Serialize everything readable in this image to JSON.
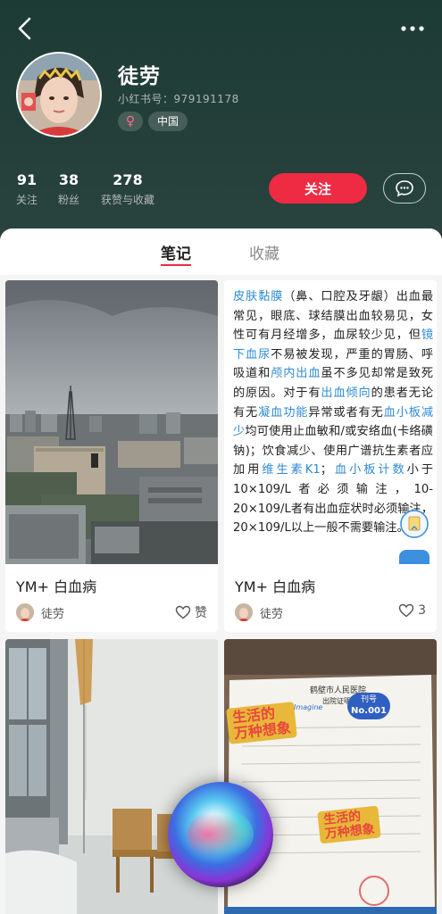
{
  "profile": {
    "nickname": "徒劳",
    "redbook_id": "小红书号：979191178",
    "gender_symbol": "♀",
    "region": "中国",
    "stats": [
      {
        "num": "91",
        "label": "关注"
      },
      {
        "num": "38",
        "label": "粉丝"
      },
      {
        "num": "278",
        "label": "获赞与收藏"
      }
    ],
    "follow_label": "关注"
  },
  "tabs": [
    {
      "label": "笔记",
      "active": true
    },
    {
      "label": "收藏",
      "active": false
    }
  ],
  "notes": [
    {
      "title": "YM+ 白血病",
      "author": "徒劳",
      "likes": "赞"
    },
    {
      "title": "YM+ 白血病",
      "author": "徒劳",
      "likes": "3"
    }
  ],
  "note_text": {
    "segments": [
      [
        "皮肤黏膜",
        true
      ],
      [
        "（鼻、口腔及牙龈）出血最常见，眼底、球结膜出血较易见，女性可有月经增多，血尿较少见，但",
        false
      ],
      [
        "镜下血尿",
        true
      ],
      [
        "不易被发现，严重的胃肠、呼吸道和",
        false
      ],
      [
        "颅内出血",
        true
      ],
      [
        "虽不多见却常是致死的原因。对于有",
        false
      ],
      [
        "出血倾向",
        true
      ],
      [
        "的患者无论有无",
        false
      ],
      [
        "凝血功能",
        true
      ],
      [
        "异常或者有无",
        false
      ],
      [
        "血小板减少",
        true
      ],
      [
        "均可使用止血敏和/或安络血(卡络磺钠)；饮食减少、使用广谱抗生素者应加用",
        false
      ],
      [
        "维生素K1",
        true
      ],
      [
        "；",
        false
      ],
      [
        "血小板计数",
        true
      ],
      [
        "小于10×109/L者必须输注，10-20×109/L者有出血症状时必须输注，20×109/L以上一般不需要输注。",
        false
      ]
    ]
  },
  "photo_overlay": {
    "hospital": "鹤壁市人民医院",
    "doc_title": "出院证明",
    "sticker_top": "生活的",
    "sticker_bottom": "万种想象",
    "sticker_small": "Imagine",
    "badge_top": "刊号",
    "badge_bottom": "No.001"
  },
  "colors": {
    "accent": "#ef2a43",
    "header_bg": "#1d3b35",
    "link": "#2f8bd6"
  }
}
